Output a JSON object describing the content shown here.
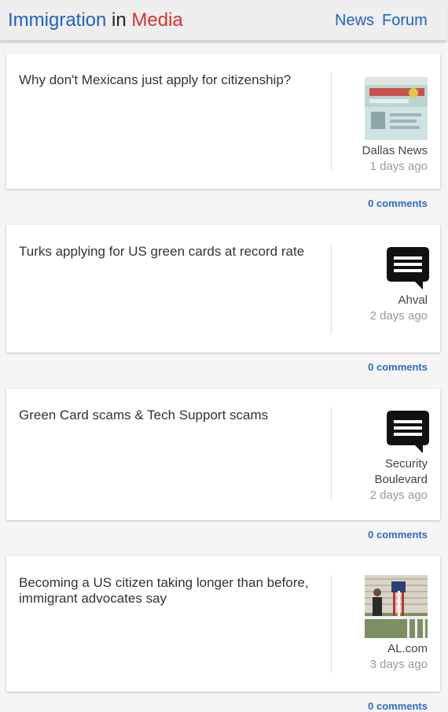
{
  "header": {
    "brand_part1": "Immigration",
    "brand_part2": "in",
    "brand_part3": "Media",
    "nav_news": "News",
    "nav_forum": "Forum"
  },
  "articles": [
    {
      "title": "Why don't Mexicans just apply for citizenship?",
      "source": "Dallas News",
      "time": "1 days ago",
      "comments": "0 comments",
      "thumbnail": "photo"
    },
    {
      "title": "Turks applying for US green cards at record rate",
      "source": "Ahval",
      "time": "2 days ago",
      "comments": "0 comments",
      "thumbnail": "chat-icon"
    },
    {
      "title": "Green Card scams & Tech Support scams",
      "source": "Security Boulevard",
      "time": "2 days ago",
      "comments": "0 comments",
      "thumbnail": "chat-icon"
    },
    {
      "title": "Becoming a US citizen taking longer than before, immigrant advocates say",
      "source": "AL.com",
      "time": "3 days ago",
      "comments": "0 comments",
      "thumbnail": "photo"
    }
  ],
  "colors": {
    "brand_blue": "#1e63c4",
    "brand_red": "#d6332c",
    "link_blue": "#2e6ac4"
  }
}
